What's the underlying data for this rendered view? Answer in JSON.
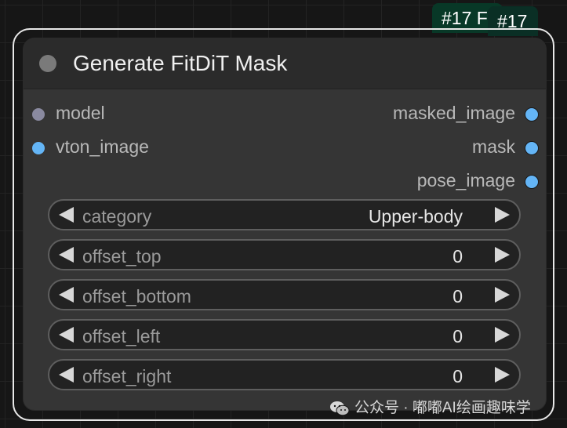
{
  "badges": {
    "back": "#17 F",
    "front": "#17"
  },
  "node": {
    "title": "Generate FitDiT Mask",
    "inputs": [
      {
        "label": "model",
        "color": "#8a8aa0"
      },
      {
        "label": "vton_image",
        "color": "#64b5f6"
      }
    ],
    "outputs": [
      {
        "label": "masked_image",
        "color": "#64b5f6"
      },
      {
        "label": "mask",
        "color": "#64b5f6"
      },
      {
        "label": "pose_image",
        "color": "#64b5f6"
      }
    ],
    "widgets": [
      {
        "label": "category",
        "value": "Upper-body"
      },
      {
        "label": "offset_top",
        "value": "0"
      },
      {
        "label": "offset_bottom",
        "value": "0"
      },
      {
        "label": "offset_left",
        "value": "0"
      },
      {
        "label": "offset_right",
        "value": "0"
      }
    ]
  },
  "watermark": {
    "text": "公众号 · 嘟嘟AI绘画趣味学",
    "icon": "wechat-icon"
  }
}
